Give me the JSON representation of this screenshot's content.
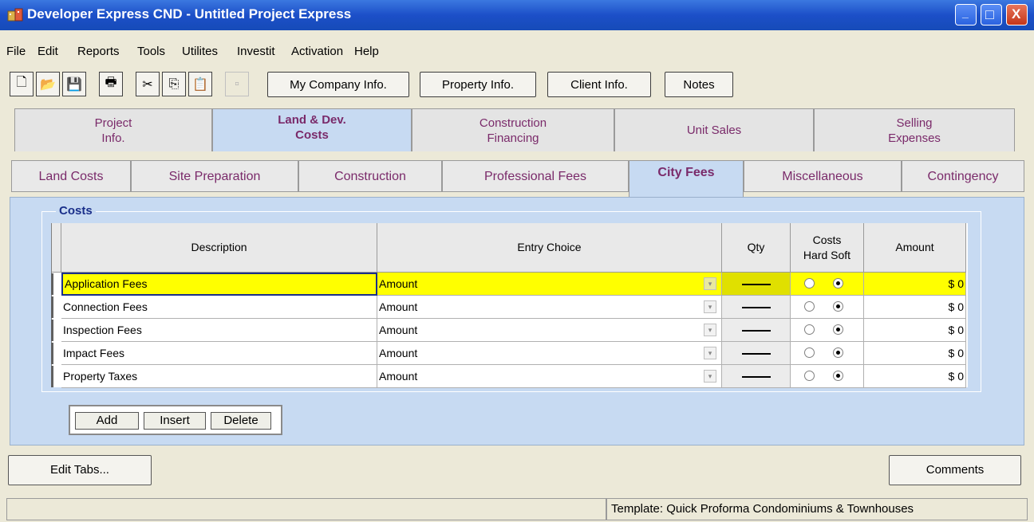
{
  "window": {
    "title": "Developer Express  CND - Untitled Project Express",
    "minimize_glyph": "_",
    "maximize_glyph": "□",
    "close_glyph": "X"
  },
  "menu": [
    "File",
    "Edit",
    "Reports",
    "Tools",
    "Utilites",
    "Investit",
    "Activation",
    "Help"
  ],
  "toolbar": {
    "icons": [
      "new-document-icon",
      "open-folder-icon",
      "save-icon",
      "print-icon",
      "cut-icon",
      "copy-icon",
      "paste-icon",
      "disabled-tool-icon"
    ],
    "glyphs": {
      "new": "🗋",
      "open": "📂",
      "save": "💾",
      "print": "🖶",
      "cut": "✂",
      "copy": "⎘",
      "paste": "📋",
      "disabled": "▫"
    },
    "buttons": [
      "My Company Info.",
      "Property Info.",
      "Client Info.",
      "Notes"
    ]
  },
  "main_tabs": [
    {
      "line1": "Project",
      "line2": "Info."
    },
    {
      "line1": "Land & Dev.",
      "line2": "Costs"
    },
    {
      "line1": "Construction",
      "line2": "Financing"
    },
    {
      "line1": "Unit Sales",
      "line2": ""
    },
    {
      "line1": "Selling",
      "line2": "Expenses"
    }
  ],
  "main_tab_active": 1,
  "sub_tabs": [
    "Land Costs",
    "Site Preparation",
    "Construction",
    "Professional Fees",
    "City Fees",
    "Miscellaneous",
    "Contingency"
  ],
  "sub_tab_active": 4,
  "group_title": "Costs",
  "table": {
    "headers": {
      "description": "Description",
      "entry_choice": "Entry Choice",
      "qty": "Qty",
      "costs_line1": "Costs",
      "costs_line2": "Hard Soft",
      "amount": "Amount"
    },
    "rows": [
      {
        "description": "Application Fees",
        "entry_choice": "Amount",
        "qty": "—",
        "cost_type": "Soft",
        "amount": "$ 0"
      },
      {
        "description": "Connection Fees",
        "entry_choice": "Amount",
        "qty": "—",
        "cost_type": "Soft",
        "amount": "$ 0"
      },
      {
        "description": "Inspection Fees",
        "entry_choice": "Amount",
        "qty": "—",
        "cost_type": "Soft",
        "amount": "$ 0"
      },
      {
        "description": "Impact Fees",
        "entry_choice": "Amount",
        "qty": "—",
        "cost_type": "Soft",
        "amount": "$ 0"
      },
      {
        "description": "Property  Taxes",
        "entry_choice": "Amount",
        "qty": "—",
        "cost_type": "Soft",
        "amount": "$ 0"
      }
    ],
    "selected_row": 0,
    "dropdown_glyph": "▾"
  },
  "row_buttons": {
    "add": "Add",
    "insert": "Insert",
    "delete": "Delete"
  },
  "bottom_buttons": {
    "edit_tabs": "Edit Tabs...",
    "comments": "Comments"
  },
  "status": {
    "left": "",
    "right": "Template: Quick Proforma Condominiums & Townhouses"
  },
  "colors": {
    "active_tab": "#c7daf2",
    "selected_row": "#ffff00",
    "tab_text": "#7a2a6a",
    "title_bar": "#1c4fc8"
  }
}
